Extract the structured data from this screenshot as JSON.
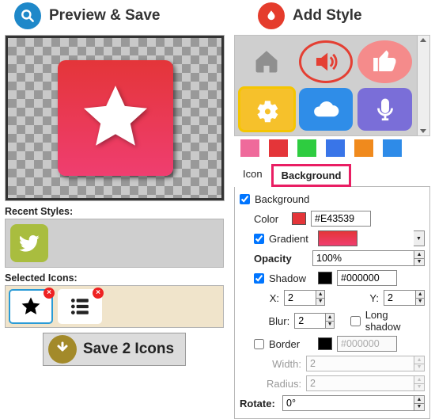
{
  "left_heading": "Preview & Save",
  "right_heading": "Add Style",
  "recent_label": "Recent Styles:",
  "selected_label": "Selected Icons:",
  "save_label": "Save 2 Icons",
  "tabs": {
    "icon": "Icon",
    "background": "Background"
  },
  "swatch_colors": [
    "#ef6a9b",
    "#e43539",
    "#2ecc40",
    "#3975e8",
    "#f08a1d",
    "#2e8be8"
  ],
  "style_tiles": [
    {
      "name": "home-icon",
      "bg": "transparent",
      "fg": "#8f8f8f"
    },
    {
      "name": "volume-icon",
      "bg": "transparent",
      "fg": "#e43f33",
      "ring": true
    },
    {
      "name": "thumb-icon",
      "bg": "#f58b8b",
      "fg": "#ffffff",
      "round": true
    },
    {
      "name": "gear-icon",
      "bg": "#f6c12b",
      "fg": "#ffffff",
      "sel": true
    },
    {
      "name": "cloud-icon",
      "bg": "#2f8de8",
      "fg": "#ffffff"
    },
    {
      "name": "mic-icon",
      "bg": "#7a6ed8",
      "fg": "#ffffff"
    }
  ],
  "bg": {
    "background_label": "Background",
    "background_checked": true,
    "color_label": "Color",
    "color_value": "#E43539",
    "gradient_label": "Gradient",
    "gradient_checked": true,
    "opacity_label": "Opacity",
    "opacity_value": "100%",
    "shadow_label": "Shadow",
    "shadow_checked": true,
    "shadow_color": "#000000",
    "x_label": "X:",
    "x_value": "2",
    "y_label": "Y:",
    "y_value": "2",
    "blur_label": "Blur:",
    "blur_value": "2",
    "long_label": "Long shadow",
    "long_checked": false,
    "border_label": "Border",
    "border_checked": false,
    "border_color": "#000000",
    "width_label": "Width:",
    "width_value": "2",
    "radius_label": "Radius:",
    "radius_value": "2",
    "rotate_label": "Rotate:",
    "rotate_value": "0°"
  }
}
